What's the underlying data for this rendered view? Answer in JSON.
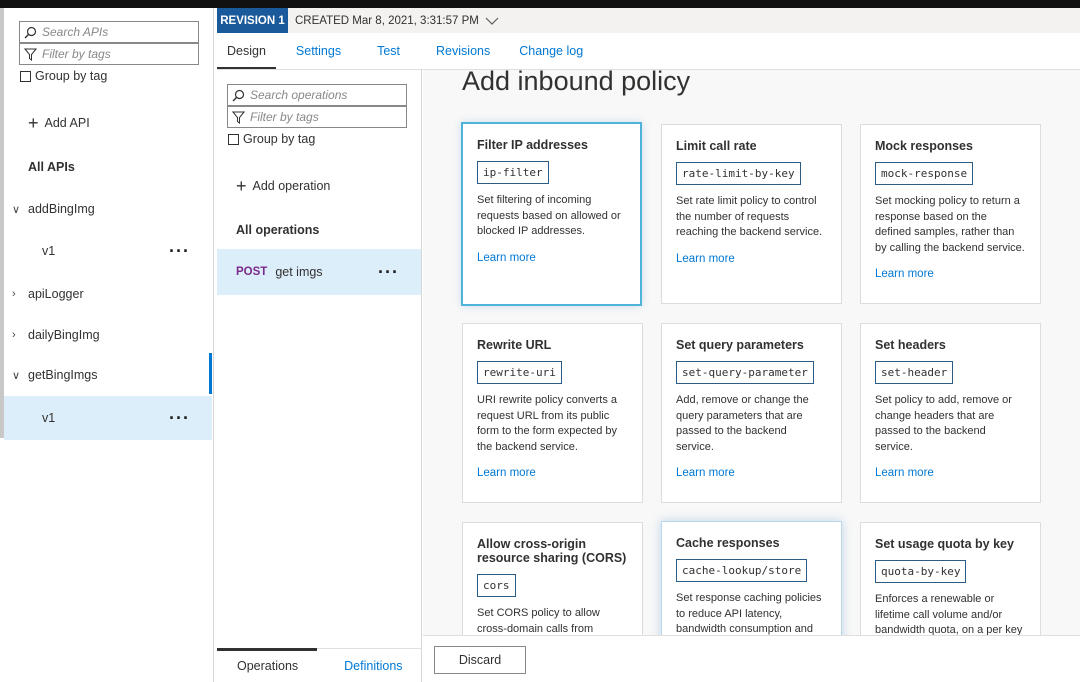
{
  "api_pane": {
    "search_placeholder": "Search APIs",
    "filter_placeholder": "Filter by tags",
    "group_by_tag": "Group by tag",
    "add_api": "Add API",
    "all_apis": "All APIs",
    "apis": [
      {
        "label": "addBingImg",
        "expanded": true,
        "version": "v1"
      },
      {
        "label": "apiLogger",
        "expanded": false
      },
      {
        "label": "dailyBingImg",
        "expanded": false
      },
      {
        "label": "getBingImgs",
        "expanded": true,
        "version": "v1",
        "selected": true
      }
    ]
  },
  "revision": {
    "badge": "REVISION 1",
    "created": "CREATED Mar 8, 2021, 3:31:57 PM"
  },
  "tabs": [
    "Design",
    "Settings",
    "Test",
    "Revisions",
    "Change log"
  ],
  "operations": {
    "search_placeholder": "Search operations",
    "filter_placeholder": "Filter by tags",
    "group_by_tag": "Group by tag",
    "add_operation": "Add operation",
    "all_operations": "All operations",
    "items": [
      {
        "method": "POST",
        "name": "get imgs"
      }
    ],
    "footer_tabs": [
      "Operations",
      "Definitions"
    ]
  },
  "policy": {
    "title": "Add inbound policy",
    "learn_more": "Learn more",
    "cards": [
      {
        "title": "Filter IP addresses",
        "code": "ip-filter",
        "desc": "Set filtering of incoming requests based on allowed or blocked IP addresses."
      },
      {
        "title": "Limit call rate",
        "code": "rate-limit-by-key",
        "desc": "Set rate limit policy to control the number of requests reaching the backend service."
      },
      {
        "title": "Mock responses",
        "code": "mock-response",
        "desc": "Set mocking policy to return a response based on the defined samples, rather than by calling the backend service."
      },
      {
        "title": "Rewrite URL",
        "code": "rewrite-uri",
        "desc": "URI rewrite policy converts a request URL from its public form to the form expected by the backend service."
      },
      {
        "title": "Set query parameters",
        "code": "set-query-parameter",
        "desc": "Add, remove or change the query parameters that are passed to the backend service."
      },
      {
        "title": "Set headers",
        "code": "set-header",
        "desc": "Set policy to add, remove or change headers that are passed to the backend service."
      },
      {
        "title": "Allow cross-origin resource sharing (CORS)",
        "code": "cors",
        "desc": "Set CORS policy to allow cross-domain calls from browser-"
      },
      {
        "title": "Cache responses",
        "code": "cache-lookup/store",
        "desc": "Set response caching policies to reduce API latency, bandwidth consumption and"
      },
      {
        "title": "Set usage quota by key",
        "code": "quota-by-key",
        "desc": "Enforces a renewable or lifetime call volume and/or bandwidth quota, on a per key"
      }
    ],
    "discard": "Discard"
  }
}
